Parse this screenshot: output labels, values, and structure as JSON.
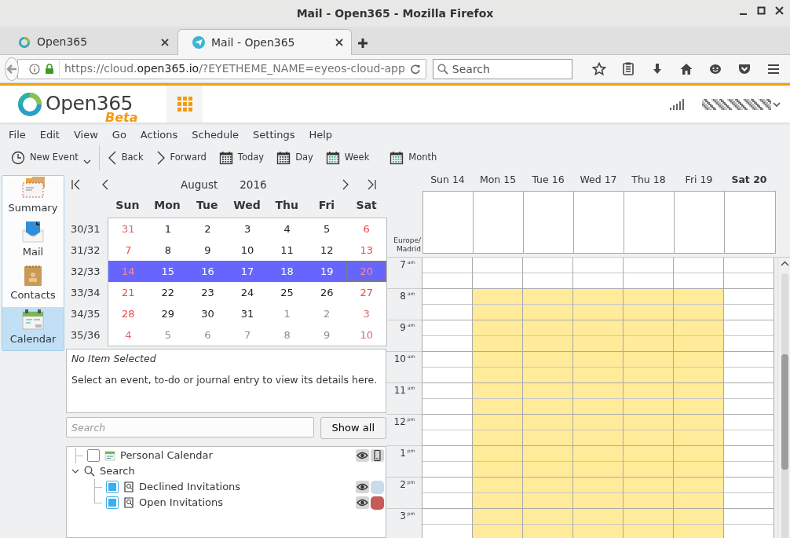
{
  "window": {
    "title": "Mail - Open365 - Mozilla Firefox"
  },
  "browser_tabs": [
    {
      "label": "Open365",
      "selected": false,
      "kind": "ring"
    },
    {
      "label": "Mail - Open365",
      "selected": true,
      "kind": "mail"
    }
  ],
  "address_bar": {
    "url_parts": [
      {
        "text": "https://cloud.",
        "highlight": false
      },
      {
        "text": "open365.io",
        "highlight": true
      },
      {
        "text": "/?EYETHEME_NAME=eyeos-cloud-app",
        "highlight": false
      }
    ]
  },
  "browser_search": {
    "placeholder": "Search"
  },
  "app_header": {
    "logo": "Open365",
    "badge": "Beta"
  },
  "menu": [
    "File",
    "Edit",
    "View",
    "Go",
    "Actions",
    "Schedule",
    "Settings",
    "Help"
  ],
  "toolbar": [
    {
      "label": "New Event",
      "kind": "new"
    },
    {
      "label": "Back",
      "kind": "back"
    },
    {
      "label": "Forward",
      "kind": "forward"
    },
    {
      "label": "Today",
      "kind": "today"
    },
    {
      "label": "Day",
      "kind": "day"
    },
    {
      "label": "Week",
      "kind": "week"
    },
    {
      "label": "Month",
      "kind": "month"
    }
  ],
  "sidebar": [
    {
      "label": "Summary",
      "kind": "summary",
      "selected": false
    },
    {
      "label": "Mail",
      "kind": "mail",
      "selected": false
    },
    {
      "label": "Contacts",
      "kind": "contacts",
      "selected": false
    },
    {
      "label": "Calendar",
      "kind": "calendar",
      "selected": true
    }
  ],
  "mini_calendar": {
    "month": "August",
    "year": "2016",
    "weekdays": [
      "Sun",
      "Mon",
      "Tue",
      "Wed",
      "Thu",
      "Fri",
      "Sat"
    ],
    "weeks": [
      {
        "label": "30/31",
        "selected": false,
        "days": [
          {
            "day": "31",
            "weekend": true,
            "other_month": true,
            "focused": false
          },
          {
            "day": "1",
            "weekend": false,
            "other_month": false,
            "focused": false
          },
          {
            "day": "2",
            "weekend": false,
            "other_month": false,
            "focused": false
          },
          {
            "day": "3",
            "weekend": false,
            "other_month": false,
            "focused": false
          },
          {
            "day": "4",
            "weekend": false,
            "other_month": false,
            "focused": false
          },
          {
            "day": "5",
            "weekend": false,
            "other_month": false,
            "focused": false
          },
          {
            "day": "6",
            "weekend": true,
            "other_month": false,
            "focused": false
          }
        ]
      },
      {
        "label": "31/32",
        "selected": false,
        "days": [
          {
            "day": "7",
            "weekend": true,
            "other_month": false,
            "focused": false
          },
          {
            "day": "8",
            "weekend": false,
            "other_month": false,
            "focused": false
          },
          {
            "day": "9",
            "weekend": false,
            "other_month": false,
            "focused": false
          },
          {
            "day": "10",
            "weekend": false,
            "other_month": false,
            "focused": false
          },
          {
            "day": "11",
            "weekend": false,
            "other_month": false,
            "focused": false
          },
          {
            "day": "12",
            "weekend": false,
            "other_month": false,
            "focused": false
          },
          {
            "day": "13",
            "weekend": true,
            "other_month": false,
            "focused": false
          }
        ]
      },
      {
        "label": "32/33",
        "selected": true,
        "days": [
          {
            "day": "14",
            "weekend": true,
            "other_month": false,
            "focused": false
          },
          {
            "day": "15",
            "weekend": false,
            "other_month": false,
            "focused": false
          },
          {
            "day": "16",
            "weekend": false,
            "other_month": false,
            "focused": false
          },
          {
            "day": "17",
            "weekend": false,
            "other_month": false,
            "focused": false
          },
          {
            "day": "18",
            "weekend": false,
            "other_month": false,
            "focused": false
          },
          {
            "day": "19",
            "weekend": false,
            "other_month": false,
            "focused": false
          },
          {
            "day": "20",
            "weekend": true,
            "other_month": false,
            "focused": true
          }
        ]
      },
      {
        "label": "33/34",
        "selected": false,
        "days": [
          {
            "day": "21",
            "weekend": true,
            "other_month": false,
            "focused": false
          },
          {
            "day": "22",
            "weekend": false,
            "other_month": false,
            "focused": false
          },
          {
            "day": "23",
            "weekend": false,
            "other_month": false,
            "focused": false
          },
          {
            "day": "24",
            "weekend": false,
            "other_month": false,
            "focused": false
          },
          {
            "day": "25",
            "weekend": false,
            "other_month": false,
            "focused": false
          },
          {
            "day": "26",
            "weekend": false,
            "other_month": false,
            "focused": false
          },
          {
            "day": "27",
            "weekend": true,
            "other_month": false,
            "focused": false
          }
        ]
      },
      {
        "label": "34/35",
        "selected": false,
        "days": [
          {
            "day": "28",
            "weekend": true,
            "other_month": false,
            "focused": false
          },
          {
            "day": "29",
            "weekend": false,
            "other_month": false,
            "focused": false
          },
          {
            "day": "30",
            "weekend": false,
            "other_month": false,
            "focused": false
          },
          {
            "day": "31",
            "weekend": false,
            "other_month": false,
            "focused": false
          },
          {
            "day": "1",
            "weekend": false,
            "other_month": true,
            "focused": false
          },
          {
            "day": "2",
            "weekend": false,
            "other_month": true,
            "focused": false
          },
          {
            "day": "3",
            "weekend": true,
            "other_month": true,
            "focused": false
          }
        ]
      },
      {
        "label": "35/36",
        "selected": false,
        "days": [
          {
            "day": "4",
            "weekend": true,
            "other_month": true,
            "focused": false
          },
          {
            "day": "5",
            "weekend": false,
            "other_month": true,
            "focused": false
          },
          {
            "day": "6",
            "weekend": false,
            "other_month": true,
            "focused": false
          },
          {
            "day": "7",
            "weekend": false,
            "other_month": true,
            "focused": false
          },
          {
            "day": "8",
            "weekend": false,
            "other_month": true,
            "focused": false
          },
          {
            "day": "9",
            "weekend": false,
            "other_month": true,
            "focused": false
          },
          {
            "day": "10",
            "weekend": true,
            "other_month": true,
            "focused": false
          }
        ]
      }
    ]
  },
  "details": {
    "title": "No Item Selected",
    "text": "Select an event, to-do or journal entry to view its details here."
  },
  "calendar_search": {
    "placeholder": "Search",
    "button": "Show all"
  },
  "tree": [
    {
      "label": "Personal Calendar",
      "kind": "calendar",
      "checked": false
    },
    {
      "label": "Search",
      "kind": "folder",
      "expanded": true,
      "children": [
        {
          "label": "Declined Invitations",
          "kind": "search",
          "checked": true,
          "color": "#c9dcec"
        },
        {
          "label": "Open Invitations",
          "kind": "search",
          "checked": true,
          "color": "#c75a5a"
        }
      ]
    }
  ],
  "week_view": {
    "timezone": [
      "Europe/",
      "Madrid"
    ],
    "days": [
      {
        "label": "Sun 14",
        "today": false
      },
      {
        "label": "Mon 15",
        "today": false
      },
      {
        "label": "Tue 16",
        "today": false
      },
      {
        "label": "Wed 17",
        "today": false
      },
      {
        "label": "Thu 18",
        "today": false
      },
      {
        "label": "Fri 19",
        "today": false
      },
      {
        "label": "Sat 20",
        "today": true
      }
    ],
    "hours": [
      {
        "hour": "7",
        "suffix": "am",
        "working": [
          false,
          false,
          false,
          false,
          false,
          false,
          false
        ]
      },
      {
        "hour": "8",
        "suffix": "am",
        "working": [
          false,
          true,
          true,
          true,
          true,
          true,
          false
        ]
      },
      {
        "hour": "9",
        "suffix": "am",
        "working": [
          false,
          true,
          true,
          true,
          true,
          true,
          false
        ]
      },
      {
        "hour": "10",
        "suffix": "am",
        "working": [
          false,
          true,
          true,
          true,
          true,
          true,
          false
        ]
      },
      {
        "hour": "11",
        "suffix": "am",
        "working": [
          false,
          true,
          true,
          true,
          true,
          true,
          false
        ]
      },
      {
        "hour": "12",
        "suffix": "pm",
        "working": [
          false,
          true,
          true,
          true,
          true,
          true,
          false
        ]
      },
      {
        "hour": "1",
        "suffix": "pm",
        "working": [
          false,
          true,
          true,
          true,
          true,
          true,
          false
        ]
      },
      {
        "hour": "2",
        "suffix": "pm",
        "working": [
          false,
          true,
          true,
          true,
          true,
          true,
          false
        ]
      },
      {
        "hour": "3",
        "suffix": "pm",
        "working": [
          false,
          true,
          true,
          true,
          true,
          true,
          false
        ]
      }
    ]
  }
}
